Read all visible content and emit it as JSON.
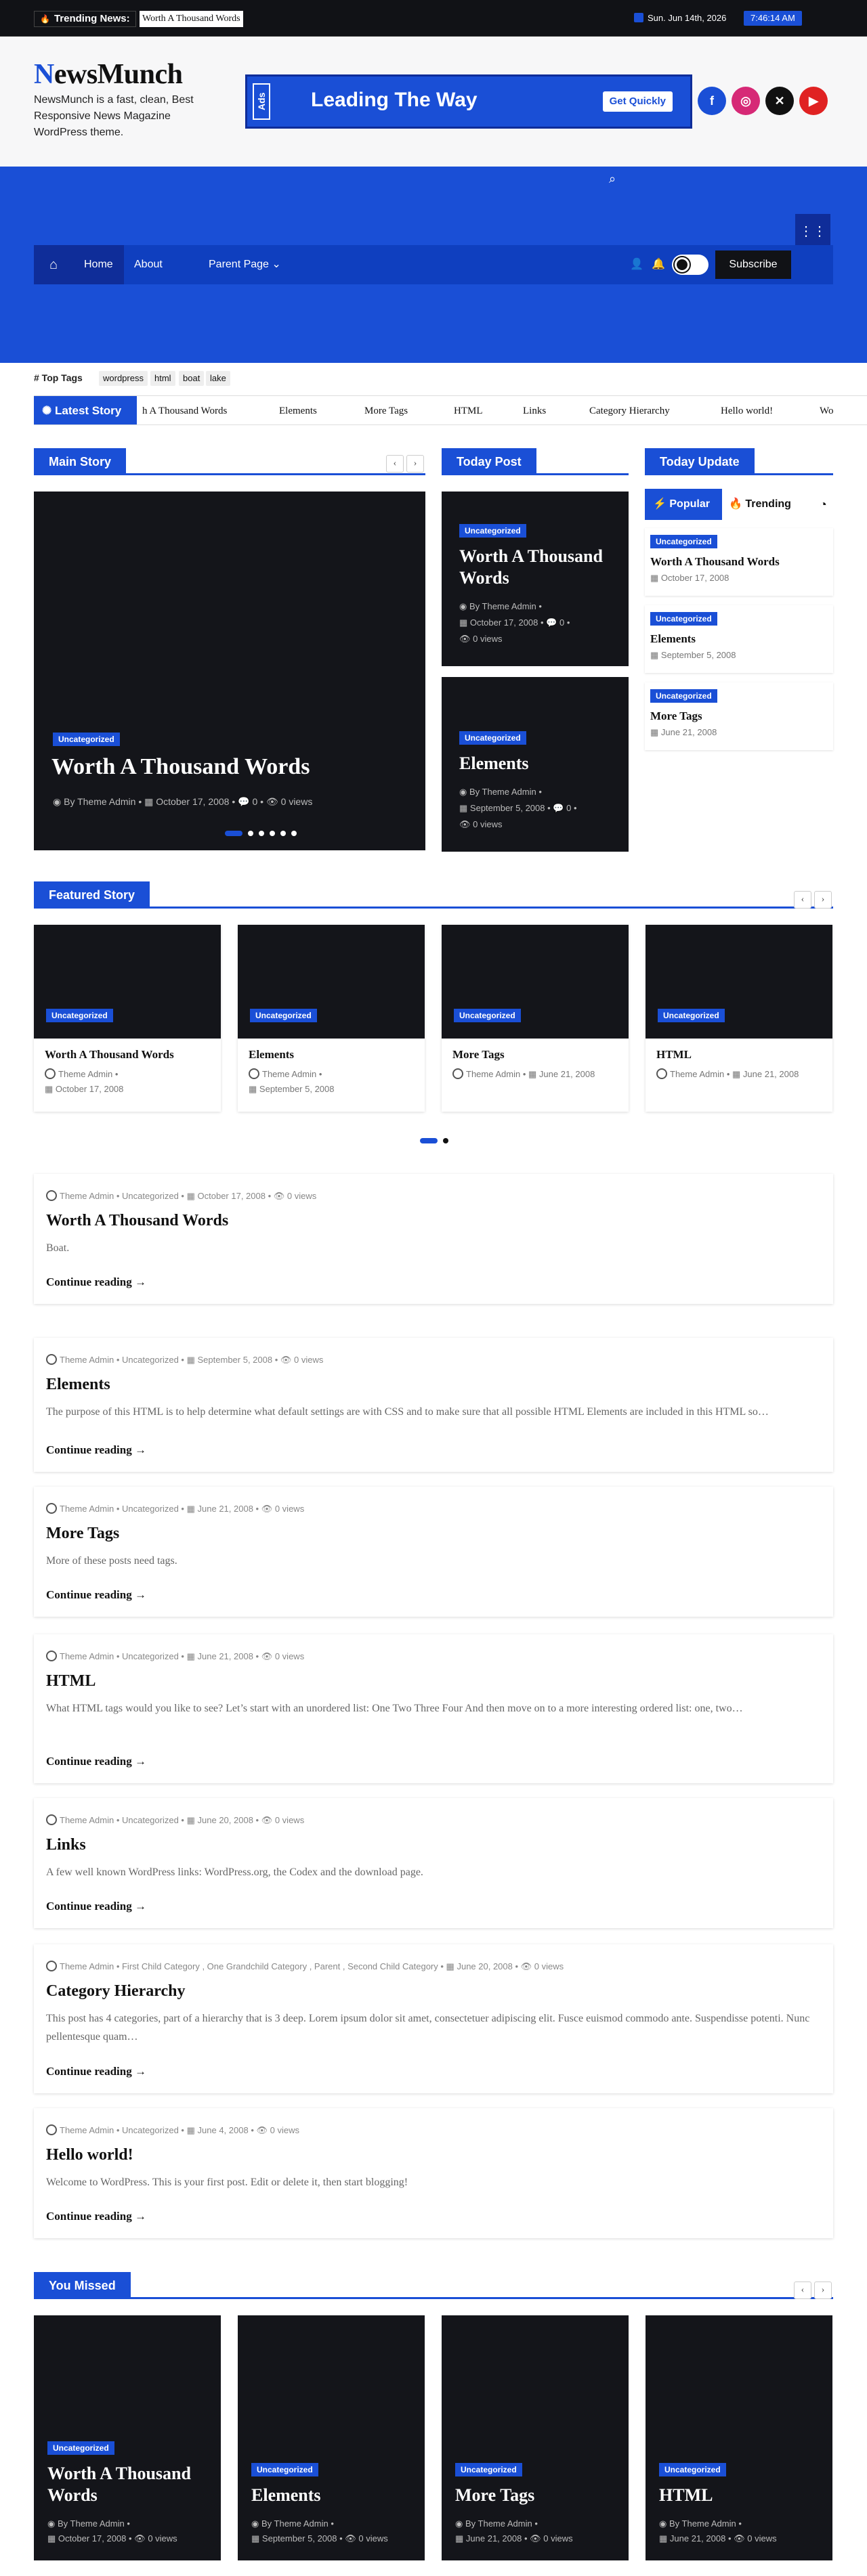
{
  "topbar": {
    "trending_label": "Trending News:",
    "trending_text": "Worth A Thousand Words",
    "date": "Sun. Jun 14th, 2026",
    "time": "7:46:14 AM"
  },
  "header": {
    "logo_first": "N",
    "logo_rest": "ewsMunch",
    "tagline": "NewsMunch is a fast, clean, Best Responsive News Magazine WordPress theme.",
    "ad": {
      "tag": "Ads",
      "title": "Leading The Way",
      "button": "Get Quickly"
    }
  },
  "nav": {
    "home": "Home",
    "about": "About",
    "parent": "Parent Page",
    "subscribe": "Subscribe"
  },
  "tags": {
    "title": "# Top Tags",
    "items": [
      "wordpress",
      "html",
      "boat",
      "lake"
    ]
  },
  "latest": {
    "label": "Latest Story",
    "items": [
      "h A Thousand Words",
      "Elements",
      "More Tags",
      "HTML",
      "Links",
      "Category Hierarchy",
      "Hello world!",
      "Wo"
    ]
  },
  "sections": {
    "main_story": "Main Story",
    "today_post": "Today Post",
    "today_update": "Today Update",
    "featured": "Featured Story",
    "you_missed": "You Missed"
  },
  "main_story": {
    "category": "Uncategorized",
    "title": "Worth A Thousand Words",
    "author": "By Theme Admin",
    "date": "October 17, 2008",
    "comments": "0",
    "views": "0 views"
  },
  "today_posts": [
    {
      "category": "Uncategorized",
      "title": "Worth A Thousand Words",
      "author": "By Theme Admin",
      "date": "October 17, 2008",
      "comments": "0",
      "views": "0 views"
    },
    {
      "category": "Uncategorized",
      "title": "Elements",
      "author": "By Theme Admin",
      "date": "September 5, 2008",
      "comments": "0",
      "views": "0 views"
    }
  ],
  "tabs": {
    "popular": "Popular",
    "trending": "Trending"
  },
  "today_update": [
    {
      "category": "Uncategorized",
      "title": "Worth A Thousand Words",
      "date": "October 17, 2008"
    },
    {
      "category": "Uncategorized",
      "title": "Elements",
      "date": "September 5, 2008"
    },
    {
      "category": "Uncategorized",
      "title": "More Tags",
      "date": "June 21, 2008"
    }
  ],
  "featured": [
    {
      "category": "Uncategorized",
      "title": "Worth A Thousand Words",
      "author": "Theme Admin",
      "date": "October 17, 2008"
    },
    {
      "category": "Uncategorized",
      "title": "Elements",
      "author": "Theme Admin",
      "date": "September 5, 2008"
    },
    {
      "category": "Uncategorized",
      "title": "More Tags",
      "author": "Theme Admin",
      "date": "June 21, 2008"
    },
    {
      "category": "Uncategorized",
      "title": "HTML",
      "author": "Theme Admin",
      "date": "June 21, 2008"
    }
  ],
  "posts": [
    {
      "author": "Theme Admin",
      "category": "Uncategorized",
      "date": "October 17, 2008",
      "views": "0 views",
      "title": "Worth A Thousand Words",
      "excerpt": "Boat.",
      "more": "Continue reading"
    },
    {
      "author": "Theme Admin",
      "category": "Uncategorized",
      "date": "September 5, 2008",
      "views": "0 views",
      "title": "Elements",
      "excerpt": "The purpose of this HTML is to help determine what default settings are with CSS and to make sure that all possible HTML Elements are included in this HTML so…",
      "more": "Continue reading"
    },
    {
      "author": "Theme Admin",
      "category": "Uncategorized",
      "date": "June 21, 2008",
      "views": "0 views",
      "title": "More Tags",
      "excerpt": "More of these posts need tags.",
      "more": "Continue reading"
    },
    {
      "author": "Theme Admin",
      "category": "Uncategorized",
      "date": "June 21, 2008",
      "views": "0 views",
      "title": "HTML",
      "excerpt": "What HTML tags would you like to see? Let’s start with an unordered list: One Two Three Four And then move on to a more interesting ordered list: one, two…",
      "more": "Continue reading"
    },
    {
      "author": "Theme Admin",
      "category": "Uncategorized",
      "date": "June 20, 2008",
      "views": "0 views",
      "title": "Links",
      "excerpt": "A few well known WordPress links: WordPress.org, the Codex and the download page.",
      "more": "Continue reading"
    },
    {
      "author": "Theme Admin",
      "category": "First Child Category , One Grandchild Category , Parent , Second Child Category",
      "date": "June 20, 2008",
      "views": "0 views",
      "title": "Category Hierarchy",
      "excerpt": "This post has 4 categories, part of a hierarchy that is 3 deep. Lorem ipsum dolor sit amet, consectetuer adipiscing elit. Fusce euismod commodo ante. Suspendisse potenti. Nunc pellentesque quam…",
      "more": "Continue reading"
    },
    {
      "author": "Theme Admin",
      "category": "Uncategorized",
      "date": "June 4, 2008",
      "views": "0 views",
      "title": "Hello world!",
      "excerpt": "Welcome to WordPress. This is your first post. Edit or delete it, then start blogging!",
      "more": "Continue reading"
    }
  ],
  "missed": [
    {
      "category": "Uncategorized",
      "title": "Worth A Thousand Words",
      "author": "By Theme Admin",
      "date": "October 17, 2008",
      "views": "0 views"
    },
    {
      "category": "Uncategorized",
      "title": "Elements",
      "author": "By Theme Admin",
      "date": "September 5, 2008",
      "views": "0 views"
    },
    {
      "category": "Uncategorized",
      "title": "More Tags",
      "author": "By Theme Admin",
      "date": "June 21, 2008",
      "views": "0 views"
    },
    {
      "category": "Uncategorized",
      "title": "HTML",
      "author": "By Theme Admin",
      "date": "June 21, 2008",
      "views": "0 views"
    }
  ],
  "colors": {
    "accent": "#1a4fd6",
    "dark": "#14151a",
    "topbar": "#111216"
  }
}
